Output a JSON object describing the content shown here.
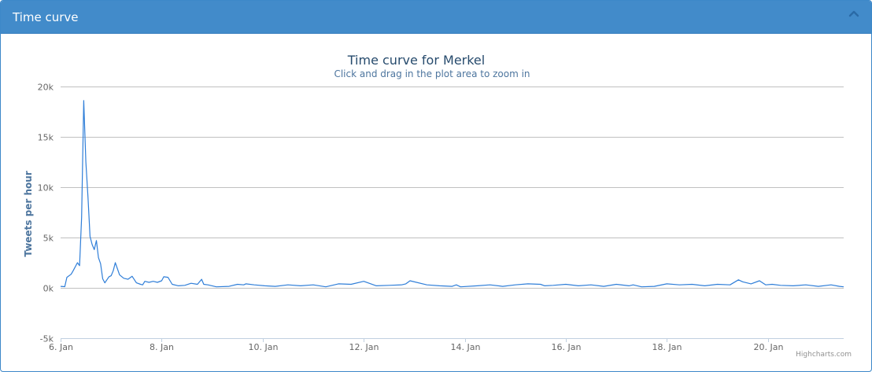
{
  "panel": {
    "title": "Time curve",
    "collapse_icon": "chevron-up-icon"
  },
  "colors": {
    "header": "#428bca",
    "series": "#2f7ed8",
    "title": "#274b6d",
    "subtitle": "#4d759e",
    "grid": "#c0c0c0",
    "axis_label": "#666666"
  },
  "credits": "Highcharts.com",
  "chart_data": {
    "type": "line",
    "title": "Time curve for Merkel",
    "subtitle": "Click and drag in the plot area to zoom in",
    "xlabel": "",
    "ylabel": "Tweets per hour",
    "xlim": [
      "2017-01-06",
      "2017-01-21T12:00"
    ],
    "ylim": [
      -5000,
      20000
    ],
    "yticks": [
      -5000,
      0,
      5000,
      10000,
      15000,
      20000
    ],
    "ytick_labels": [
      "-5k",
      "0k",
      "5k",
      "10k",
      "15k",
      "20k"
    ],
    "xtick_labels": [
      "6. Jan",
      "8. Jan",
      "10. Jan",
      "12. Jan",
      "14. Jan",
      "16. Jan",
      "18. Jan",
      "20. Jan"
    ],
    "grid": true,
    "legend": "none",
    "series": [
      {
        "x": [
          "2017-01-06T00:00",
          "2017-01-06T02:00",
          "2017-01-06T03:00",
          "2017-01-06T05:00",
          "2017-01-06T06:00",
          "2017-01-06T08:00",
          "2017-01-06T09:00",
          "2017-01-06T10:00",
          "2017-01-06T11:00",
          "2017-01-06T12:00",
          "2017-01-06T13:00",
          "2017-01-06T14:00",
          "2017-01-06T15:00",
          "2017-01-06T16:00",
          "2017-01-06T17:00",
          "2017-01-06T18:00",
          "2017-01-06T19:00",
          "2017-01-06T20:00",
          "2017-01-06T21:00",
          "2017-01-06T22:00",
          "2017-01-06T23:00",
          "2017-01-07T00:00",
          "2017-01-07T01:00",
          "2017-01-07T02:00",
          "2017-01-07T04:00",
          "2017-01-07T06:00",
          "2017-01-07T08:00",
          "2017-01-07T10:00",
          "2017-01-07T12:00",
          "2017-01-07T14:00",
          "2017-01-07T15:00",
          "2017-01-07T16:00",
          "2017-01-07T18:00",
          "2017-01-07T20:00",
          "2017-01-07T22:00",
          "2017-01-08T00:00",
          "2017-01-08T01:00",
          "2017-01-08T03:00",
          "2017-01-08T05:00",
          "2017-01-08T08:00",
          "2017-01-08T11:00",
          "2017-01-08T14:00",
          "2017-01-08T17:00",
          "2017-01-08T19:00",
          "2017-01-08T20:00",
          "2017-01-08T22:00",
          "2017-01-09T02:00",
          "2017-01-09T08:00",
          "2017-01-09T12:00",
          "2017-01-09T15:00",
          "2017-01-09T16:00",
          "2017-01-09T20:00",
          "2017-01-10T01:00",
          "2017-01-10T06:00",
          "2017-01-10T12:00",
          "2017-01-10T18:00",
          "2017-01-11T00:00",
          "2017-01-11T06:00",
          "2017-01-11T12:00",
          "2017-01-11T18:00",
          "2017-01-12T00:00",
          "2017-01-12T06:00",
          "2017-01-12T12:00",
          "2017-01-12T18:00",
          "2017-01-12T20:00",
          "2017-01-12T22:00",
          "2017-01-13T06:00",
          "2017-01-13T12:00",
          "2017-01-13T18:00",
          "2017-01-13T20:00",
          "2017-01-13T22:00",
          "2017-01-14T06:00",
          "2017-01-14T12:00",
          "2017-01-14T18:00",
          "2017-01-15T00:00",
          "2017-01-15T06:00",
          "2017-01-15T12:00",
          "2017-01-15T14:00",
          "2017-01-15T18:00",
          "2017-01-16T00:00",
          "2017-01-16T06:00",
          "2017-01-16T12:00",
          "2017-01-16T18:00",
          "2017-01-17T00:00",
          "2017-01-17T06:00",
          "2017-01-17T08:00",
          "2017-01-17T12:00",
          "2017-01-17T18:00",
          "2017-01-18T00:00",
          "2017-01-18T06:00",
          "2017-01-18T12:00",
          "2017-01-18T18:00",
          "2017-01-19T00:00",
          "2017-01-19T06:00",
          "2017-01-19T10:00",
          "2017-01-19T12:00",
          "2017-01-19T16:00",
          "2017-01-19T20:00",
          "2017-01-19T23:00",
          "2017-01-20T02:00",
          "2017-01-20T06:00",
          "2017-01-20T12:00",
          "2017-01-20T18:00",
          "2017-01-21T00:00",
          "2017-01-21T06:00",
          "2017-01-21T10:00",
          "2017-01-21T12:00"
        ],
        "values": [
          150,
          120,
          1050,
          1350,
          1700,
          2500,
          2200,
          7000,
          18600,
          12500,
          9000,
          5100,
          4300,
          3800,
          4700,
          3000,
          2400,
          900,
          500,
          800,
          1100,
          1200,
          1700,
          2500,
          1300,
          950,
          850,
          1150,
          500,
          350,
          300,
          650,
          550,
          650,
          550,
          700,
          1100,
          1050,
          350,
          200,
          250,
          450,
          350,
          850,
          350,
          300,
          100,
          150,
          350,
          300,
          400,
          300,
          200,
          150,
          300,
          200,
          300,
          100,
          400,
          350,
          650,
          200,
          250,
          300,
          400,
          700,
          300,
          200,
          150,
          300,
          100,
          200,
          300,
          150,
          300,
          400,
          350,
          200,
          250,
          350,
          200,
          300,
          150,
          350,
          200,
          300,
          100,
          150,
          400,
          300,
          350,
          200,
          350,
          300,
          800,
          600,
          400,
          700,
          300,
          350,
          250,
          200,
          300,
          150,
          300,
          150,
          100
        ]
      }
    ]
  }
}
